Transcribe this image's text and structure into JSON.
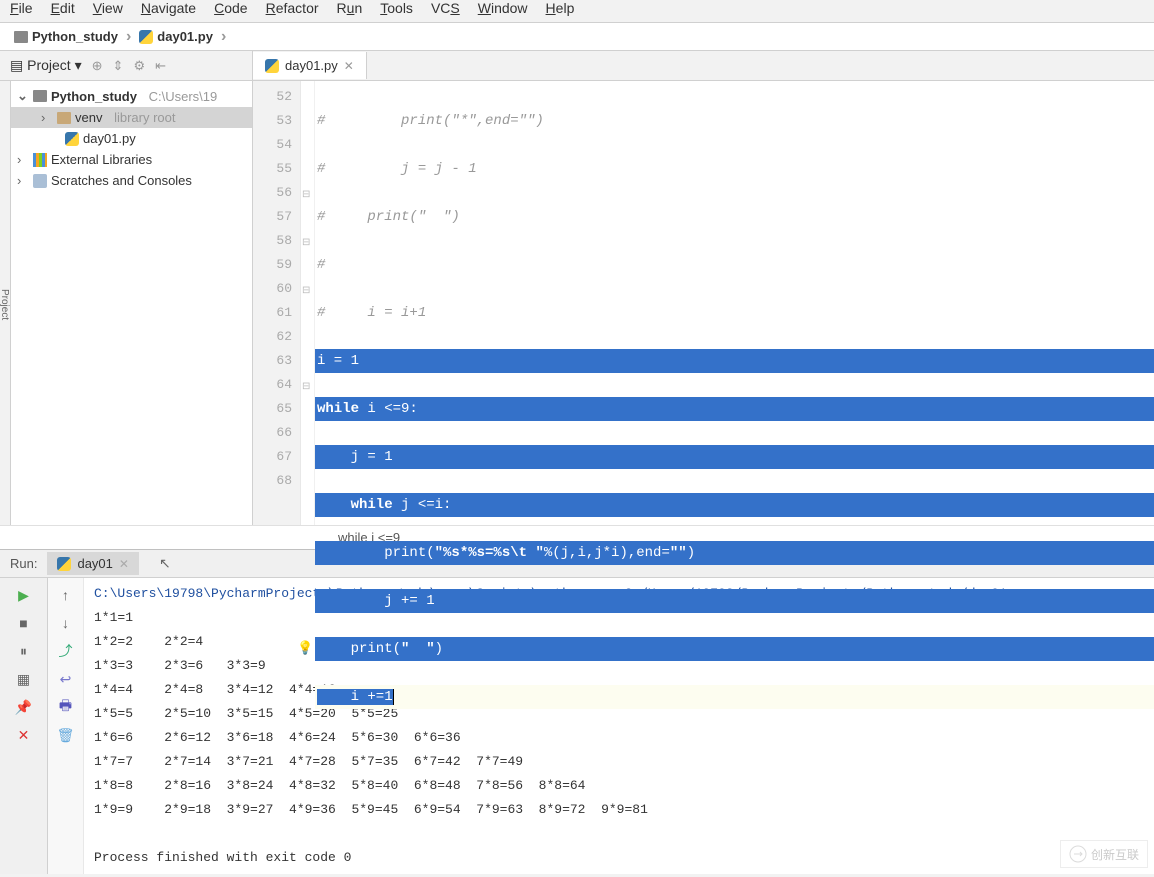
{
  "menu": {
    "file": "File",
    "edit": "Edit",
    "view": "View",
    "navigate": "Navigate",
    "code": "Code",
    "refactor": "Refactor",
    "run": "Run",
    "tools": "Tools",
    "vcs": "VCS",
    "window": "Window",
    "help": "Help"
  },
  "breadcrumb": {
    "root": "Python_study",
    "file": "day01.py"
  },
  "project_label": "Project",
  "editor_tab": "day01.py",
  "tree": {
    "root": "Python_study",
    "root_path": "C:\\Users\\19",
    "venv": "venv",
    "venv_hint": "library root",
    "file": "day01.py",
    "ext": "External Libraries",
    "scratch": "Scratches and Consoles"
  },
  "gutter_lines": [
    "52",
    "53",
    "54",
    "55",
    "56",
    "57",
    "58",
    "59",
    "60",
    "61",
    "62",
    "63",
    "64",
    "65",
    "66",
    "67",
    "68"
  ],
  "code": {
    "l52": "#         print(\"*\",end=\"\")",
    "l53": "#         j = j - 1",
    "l54": "#     print(\"  \")",
    "l55": "#",
    "l56": "#     i = i+1",
    "l57_a": "i = 1",
    "l58_a": "while",
    "l58_b": " i <=9:",
    "l59": "    j = 1",
    "l60_a": "    while",
    "l60_b": " j <=i:",
    "l61_a": "        print(",
    "l61_b": "\"%s*%s=%s\\t \"",
    "l61_c": "%(j,i,j*i),end=",
    "l61_d": "\"\"",
    "l61_e": ")",
    "l62": "        j += 1",
    "l63_a": "    print(",
    "l63_b": "\"  \"",
    "l63_c": ")",
    "l64": "    i +=1"
  },
  "crumb_status": "while i <=9",
  "run": {
    "label": "Run:",
    "tab": "day01",
    "cmd": "C:\\Users\\19798\\PycharmProjects\\Python_study\\venv\\Scripts\\python.exe C:/Users/19798/PycharmProjects/Python_study/day01.py",
    "out": "1*1=1\n1*2=2    2*2=4\n1*3=3    2*3=6   3*3=9\n1*4=4    2*4=8   3*4=12  4*4=16\n1*5=5    2*5=10  3*5=15  4*5=20  5*5=25\n1*6=6    2*6=12  3*6=18  4*6=24  5*6=30  6*6=36\n1*7=7    2*7=14  3*7=21  4*7=28  5*7=35  6*7=42  7*7=49\n1*8=8    2*8=16  3*8=24  4*8=32  5*8=40  6*8=48  7*8=56  8*8=64\n1*9=9    2*9=18  3*9=27  4*9=36  5*9=45  6*9=54  7*9=63  8*9=72  9*9=81",
    "exit": "Process finished with exit code 0"
  },
  "watermark": "创新互联"
}
